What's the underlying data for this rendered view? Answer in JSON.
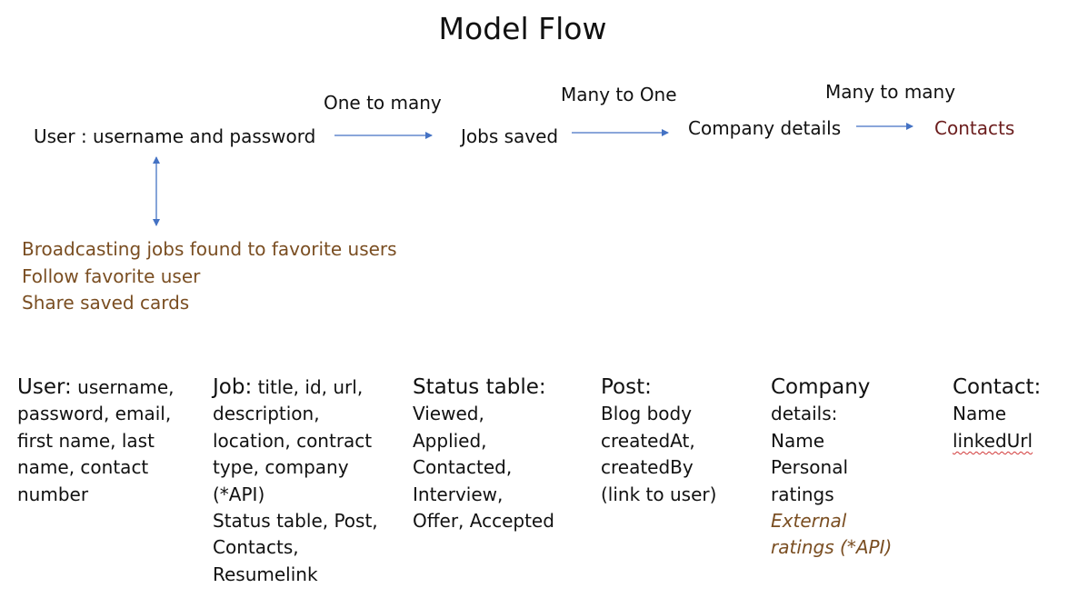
{
  "title": "Model Flow",
  "flow": {
    "nodes": {
      "user": "User : username and password",
      "jobs": "Jobs saved",
      "company": "Company details",
      "contacts": "Contacts"
    },
    "relations": {
      "user_jobs": "One to many",
      "jobs_company": "Many to One",
      "company_contacts": "Many to many"
    }
  },
  "features": [
    "Broadcasting jobs found to favorite users",
    "Follow favorite user",
    "Share saved cards"
  ],
  "models": {
    "user": {
      "head": "User:",
      "lines": [
        " username,",
        "password, email,",
        "first name, last",
        "name, contact",
        "number"
      ]
    },
    "job": {
      "head": "Job:",
      "lines": [
        " title, id, url,",
        "description,",
        "location, contract",
        "type, company",
        "(*API)",
        "Status table, Post,",
        "Contacts,",
        "Resumelink"
      ]
    },
    "status": {
      "head": "Status table:",
      "lines": [
        "Viewed,",
        "Applied,",
        "Contacted,",
        "Interview,",
        "Offer, Accepted"
      ]
    },
    "post": {
      "head": "Post:",
      "lines": [
        "Blog body",
        "createdAt,",
        "createdBy",
        "(link to user)"
      ]
    },
    "company": {
      "head": "Company",
      "lines": [
        "details:",
        "Name",
        "Personal",
        "ratings"
      ],
      "italic_lines": [
        "External",
        "ratings (*API)"
      ]
    },
    "contact": {
      "head": "Contact:",
      "lines": [
        "Name",
        "linkedUrl"
      ]
    }
  },
  "colors": {
    "arrow": "#4472c4",
    "feature_text": "#7a4e22",
    "contacts_text": "#6b1d1d"
  }
}
